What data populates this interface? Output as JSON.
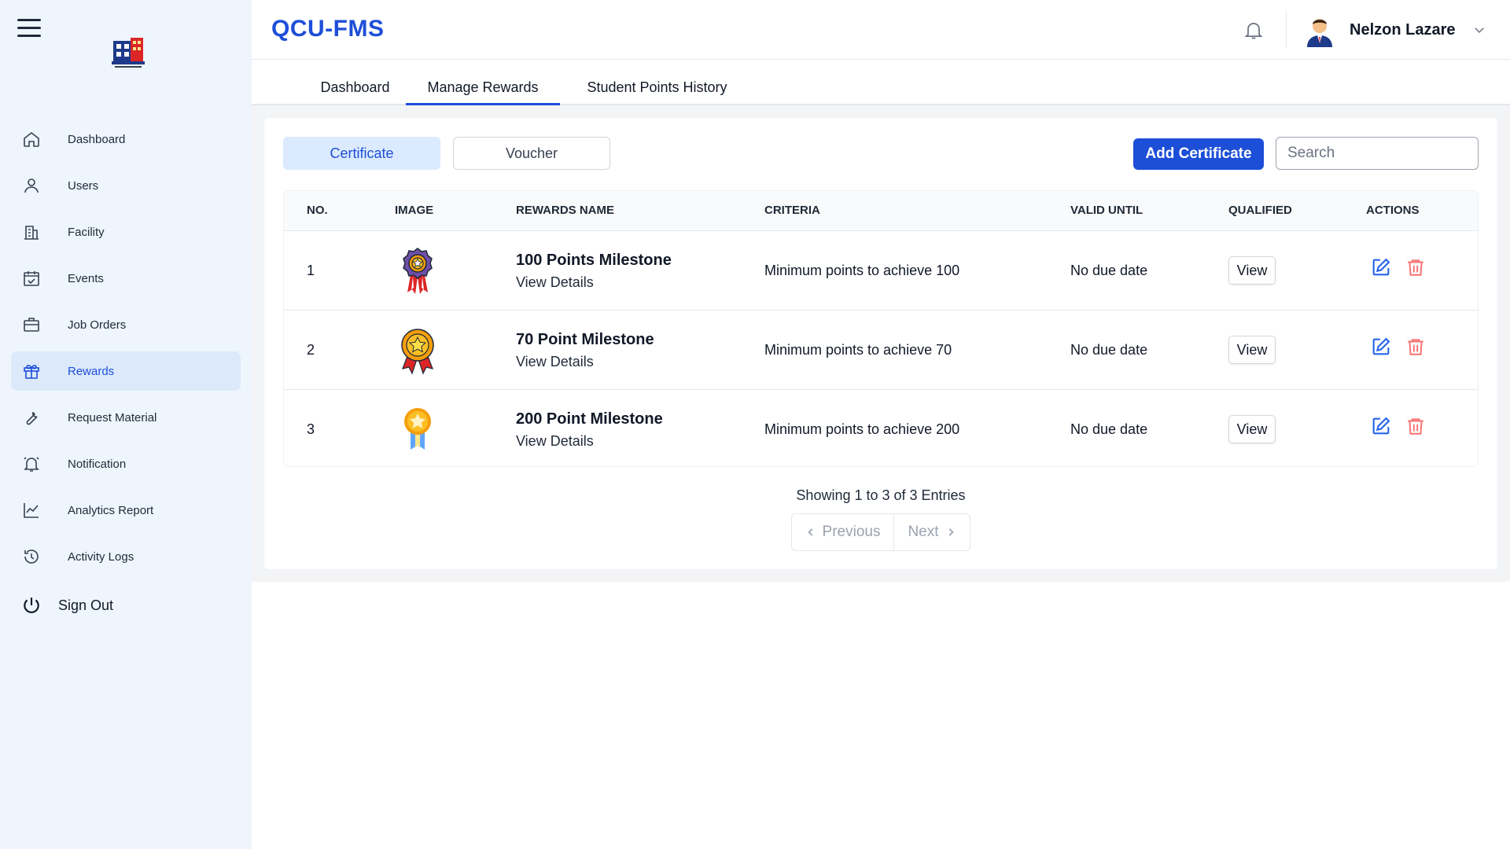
{
  "app": {
    "brand": "QCU-FMS"
  },
  "sidebar": {
    "items": [
      {
        "label": "Dashboard",
        "icon": "home-icon"
      },
      {
        "label": "Users",
        "icon": "user-icon"
      },
      {
        "label": "Facility",
        "icon": "building-icon"
      },
      {
        "label": "Events",
        "icon": "calendar-check-icon"
      },
      {
        "label": "Job Orders",
        "icon": "briefcase-icon"
      },
      {
        "label": "Rewards",
        "icon": "gift-icon",
        "active": true
      },
      {
        "label": "Request Material",
        "icon": "wrench-icon"
      },
      {
        "label": "Notification",
        "icon": "bell-icon"
      },
      {
        "label": "Analytics Report",
        "icon": "chart-line-icon"
      },
      {
        "label": "Activity Logs",
        "icon": "history-icon"
      }
    ],
    "sign_out": "Sign Out"
  },
  "header": {
    "user_name": "Nelzon Lazare"
  },
  "tabs": [
    {
      "label": "Dashboard"
    },
    {
      "label": "Manage Rewards",
      "active": true
    },
    {
      "label": "Student Points History"
    }
  ],
  "toolbar": {
    "certificate": "Certificate",
    "voucher": "Voucher",
    "add_button": "Add Certificate",
    "search_placeholder": "Search"
  },
  "table": {
    "columns": [
      "NO.",
      "IMAGE",
      "REWARDS NAME",
      "CRITERIA",
      "VALID UNTIL",
      "QUALIFIED",
      "ACTIONS"
    ],
    "rows": [
      {
        "no": "1",
        "name": "100 Points Milestone",
        "details": "View Details",
        "criteria": "Minimum points to achieve 100",
        "valid_until": "No due date",
        "qualified": "View",
        "image": "purple-rosette-medal-icon"
      },
      {
        "no": "2",
        "name": "70 Point Milestone",
        "details": "View Details",
        "criteria": "Minimum points to achieve 70",
        "valid_until": "No due date",
        "qualified": "View",
        "image": "gold-red-rosette-medal-icon"
      },
      {
        "no": "3",
        "name": "200 Point Milestone",
        "details": "View Details",
        "criteria": "Minimum points to achieve 200",
        "valid_until": "No due date",
        "qualified": "View",
        "image": "gold-star-ribbon-medal-icon"
      }
    ]
  },
  "pagination": {
    "summary": "Showing 1 to 3 of 3 Entries",
    "previous": "Previous",
    "next": "Next"
  },
  "colors": {
    "primary": "#1d4ed8",
    "sidebar_bg": "#eef5fd",
    "active_item_bg": "#dbe9fb",
    "danger": "#f87171"
  }
}
